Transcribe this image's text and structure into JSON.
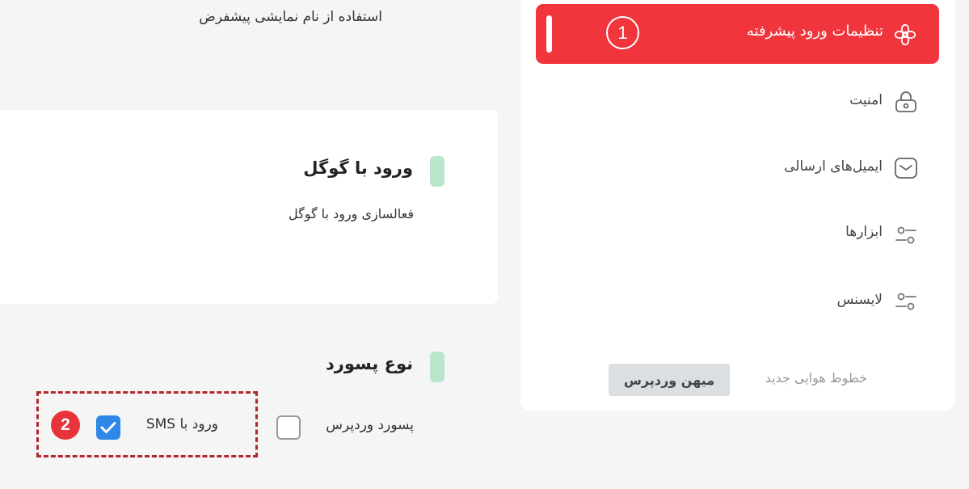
{
  "top_text": "استفاده از نام نمایشی پیشفرض",
  "google_section": {
    "title": "ورود با گوگل",
    "description": "فعالسازی ورود با گوگل"
  },
  "password_section": {
    "title": "نوع پسورد",
    "options": [
      {
        "label": "پسورد وردپرس",
        "checked": false
      },
      {
        "label": "ورود با SMS",
        "checked": true
      }
    ],
    "annotation_number": "2"
  },
  "sidebar": {
    "active_item": {
      "label": "تنظیمات ورود پیشرفته",
      "icon": "flower-gear-icon",
      "annotation_number": "1"
    },
    "items": [
      {
        "label": "امنیت",
        "icon": "lock-icon"
      },
      {
        "label": "ایمیل‌های ارسالی",
        "icon": "mail-icon"
      },
      {
        "label": "ابزارها",
        "icon": "sliders-icon"
      },
      {
        "label": "لایسنس",
        "icon": "sliders-icon"
      }
    ],
    "footer_text": "خطوط هوایی جدید",
    "footer_tag": "میهن وردپرس"
  },
  "colors": {
    "accent_red": "#f0353c",
    "badge_red": "#e8333a",
    "checkbox_blue": "#2f87e8",
    "section_accent_green": "#b9e7cb",
    "dashed_border": "#b3262d"
  }
}
